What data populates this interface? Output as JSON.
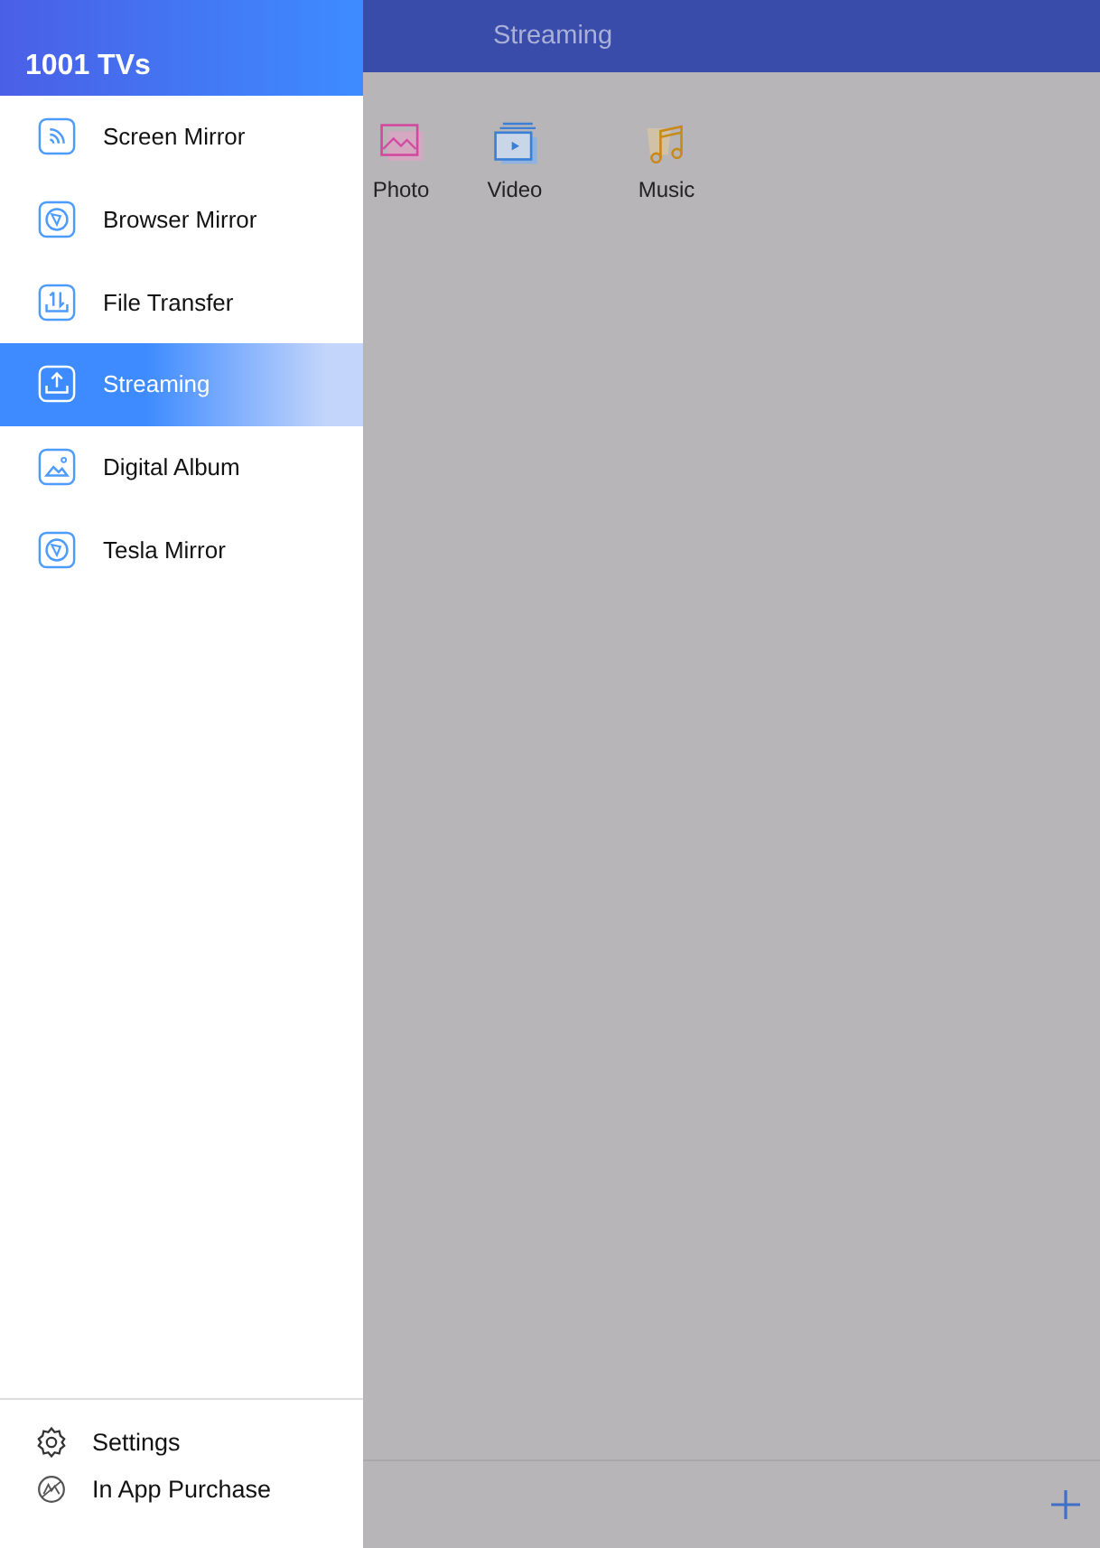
{
  "drawer": {
    "title": "1001 TVs",
    "items": [
      {
        "label": "Screen Mirror",
        "kind": "cast",
        "selected": false
      },
      {
        "label": "Browser Mirror",
        "kind": "browser",
        "selected": false
      },
      {
        "label": "File Transfer",
        "kind": "transfer",
        "selected": false
      },
      {
        "label": "Streaming",
        "kind": "upload",
        "selected": true
      },
      {
        "label": "Digital Album",
        "kind": "album",
        "selected": false
      },
      {
        "label": "Tesla Mirror",
        "kind": "browser",
        "selected": false
      }
    ],
    "footer": [
      {
        "label": "Settings",
        "kind": "gear"
      },
      {
        "label": "In App Purchase",
        "kind": "badge"
      }
    ]
  },
  "main": {
    "title": "Streaming",
    "categories": [
      {
        "label": "Photo",
        "kind": "photo"
      },
      {
        "label": "Video",
        "kind": "video"
      },
      {
        "label": "Music",
        "kind": "music"
      }
    ]
  }
}
